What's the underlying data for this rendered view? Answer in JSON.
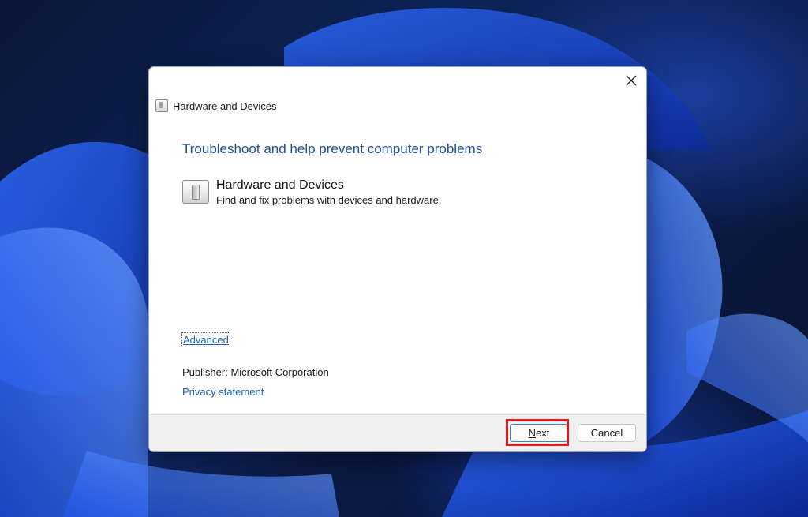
{
  "desktop": {
    "wallpaper": "windows-11-bloom",
    "accent_color": "#1a4fe0"
  },
  "dialog": {
    "window_title": "Hardware and Devices",
    "close_icon": "close-icon",
    "heading": "Troubleshoot and help prevent computer problems",
    "heading_color": "#1e4f93",
    "troubleshooter": {
      "icon": "hardware-devices-icon",
      "title": "Hardware and Devices",
      "description": "Find and fix problems with devices and hardware."
    },
    "advanced_link": "Advanced",
    "publisher_label": "Publisher:",
    "publisher_value": "Microsoft Corporation",
    "privacy_link": "Privacy statement",
    "link_color": "#1a63b6"
  },
  "footer": {
    "next_label_accel": "N",
    "next_label_rest": "ext",
    "cancel_label": "Cancel"
  },
  "annotation": {
    "highlight_color": "#e3171b",
    "highlight_target": "next-button"
  }
}
